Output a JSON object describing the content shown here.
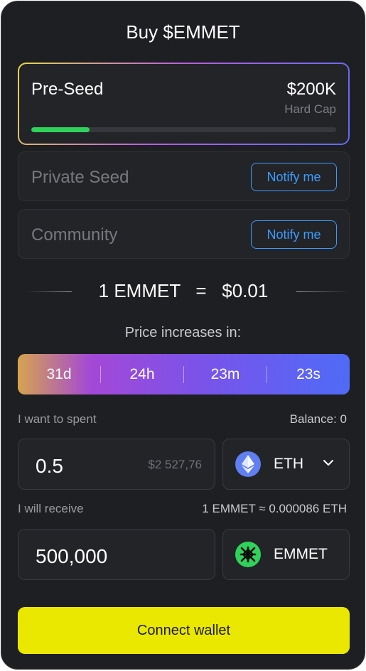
{
  "title": "Buy $EMMET",
  "tiers": {
    "active": {
      "name": "Pre-Seed",
      "cap": "$200K",
      "cap_label": "Hard Cap",
      "progress": 0.19,
      "progress_color": "#2fd25a"
    },
    "private_seed": {
      "name": "Private Seed",
      "action": "Notify me"
    },
    "community": {
      "name": "Community",
      "action": "Notify me"
    }
  },
  "rate": {
    "token_amount": "1 EMMET",
    "equals": "=",
    "price": "$0.01"
  },
  "price_increase": {
    "label": "Price increases in:",
    "days": "31d",
    "hours": "24h",
    "minutes": "23m",
    "seconds": "23s"
  },
  "spend": {
    "label": "I want to spent",
    "balance": "Balance: 0",
    "value": "0.5",
    "usd_value": "$2 527,76",
    "token": "ETH",
    "token_icon": "ethereum-icon"
  },
  "receive": {
    "label": "I will receive",
    "rate": "1 EMMET ≈ 0.000086 ETH",
    "value": "500,000",
    "token": "EMMET",
    "token_icon": "emmet-logo-icon"
  },
  "connect_label": "Connect wallet",
  "colors": {
    "accent": "#ebe800",
    "link": "#3b9cff",
    "background": "#1e1f22"
  }
}
